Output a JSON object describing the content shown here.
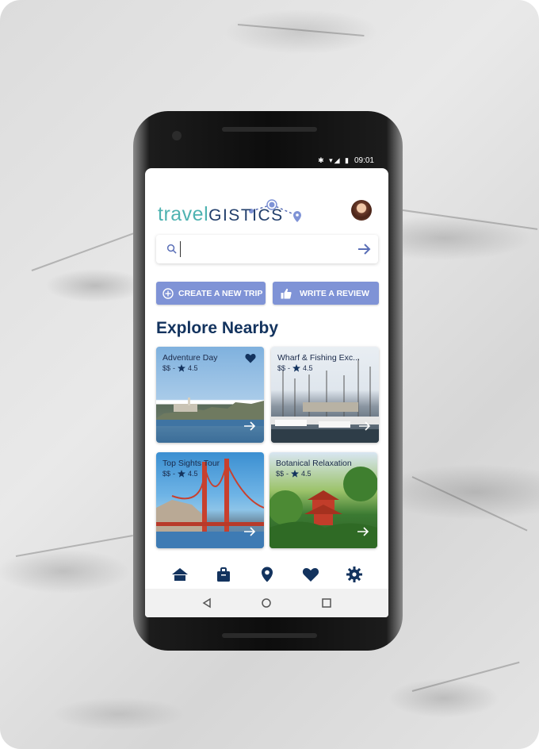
{
  "status": {
    "time": "09:01",
    "icons": "✱ ▾◢ ▮"
  },
  "app": {
    "logo_part1": "travel",
    "logo_part2": "GISTICS"
  },
  "search": {
    "placeholder": ""
  },
  "actions": {
    "create_label": "CREATE A NEW TRIP",
    "review_label": "WRITE A REVIEW"
  },
  "section": {
    "title": "Explore Nearby"
  },
  "cards": [
    {
      "title": "Adventure Day",
      "price": "$$",
      "rating": "4.5",
      "favorited": true
    },
    {
      "title": "Wharf & Fishing Exc...",
      "price": "$$",
      "rating": "4.5",
      "favorited": false
    },
    {
      "title": "Top Sights Tour",
      "price": "$$",
      "rating": "4.5",
      "favorited": false
    },
    {
      "title": "Botanical Relaxation",
      "price": "$$",
      "rating": "4.5",
      "favorited": false
    }
  ],
  "nav": [
    "home-icon",
    "bag-icon",
    "location-pin-icon",
    "heart-icon",
    "gear-icon"
  ],
  "colors": {
    "accent": "#7f93d6",
    "navy": "#13335e",
    "teal": "#4fb3b1"
  }
}
